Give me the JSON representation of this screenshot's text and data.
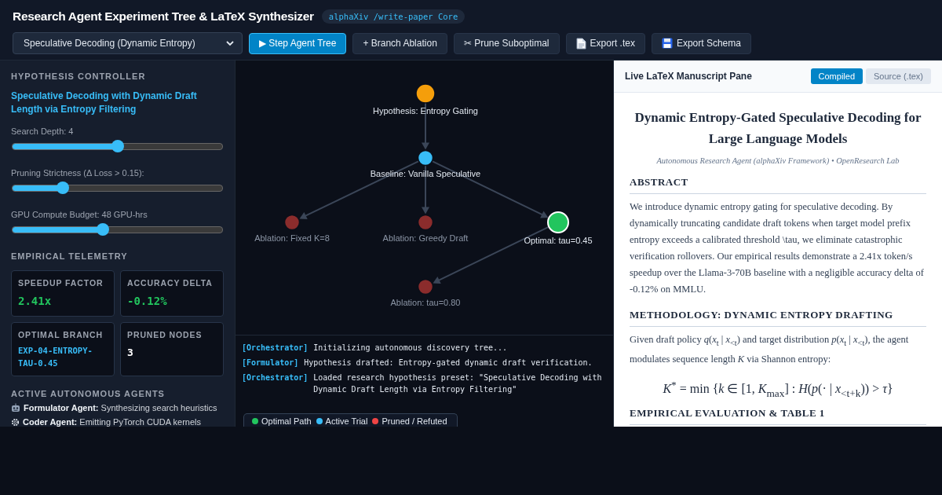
{
  "header": {
    "title": "Research Agent Experiment Tree & LaTeX Synthesizer",
    "badge": "alphaXiv /write-paper Core"
  },
  "toolbar": {
    "preset": "Speculative Decoding (Dynamic Entropy)",
    "buttons": [
      {
        "label": "▶ Step Agent Tree",
        "primary": true
      },
      {
        "label": "+ Branch Ablation",
        "primary": false
      },
      {
        "label": "✂ Prune Suboptimal",
        "primary": false
      },
      {
        "label": "Export .tex",
        "primary": false
      },
      {
        "label": "Export Schema",
        "primary": false
      }
    ]
  },
  "controller": {
    "heading": "HYPOTHESIS CONTROLLER",
    "hypothesis": "Speculative Decoding with Dynamic Draft Length via Entropy Filtering",
    "sliders": [
      {
        "label": "Search Depth: 4",
        "level": 0.5
      },
      {
        "label": "Pruning Strictness (Δ Loss > 0.15):",
        "level": 0.24
      },
      {
        "label": "GPU Compute Budget: 48 GPU-hrs",
        "level": 0.43
      }
    ]
  },
  "telemetry": {
    "heading": "EMPIRICAL TELEMETRY",
    "cards": [
      {
        "label": "SPEEDUP FACTOR",
        "value": "2.41x",
        "kind": "good"
      },
      {
        "label": "ACCURACY DELTA",
        "value": "-0.12%",
        "kind": "good"
      },
      {
        "label": "OPTIMAL BRANCH",
        "value": "EXP-04-ENTROPY-TAU-0.45",
        "kind": "id"
      },
      {
        "label": "PRUNED NODES",
        "value": "3",
        "kind": "plain"
      }
    ]
  },
  "agents": {
    "heading": "ACTIVE AUTONOMOUS AGENTS",
    "items": [
      {
        "name": "Formulator Agent:",
        "task": "Synthesizing search heuristics"
      },
      {
        "name": "Coder Agent:",
        "task": "Emitting PyTorch CUDA kernels"
      }
    ]
  },
  "tree": {
    "label": "Hypothesis: Entropy Gating",
    "kind": "hypothesis",
    "children": [
      {
        "label": "Baseline: Vanilla Speculative",
        "kind": "active",
        "children": [
          {
            "label": "Ablation: Fixed K=8",
            "kind": "pruned"
          },
          {
            "label": "Ablation: Greedy Draft",
            "kind": "pruned"
          },
          {
            "label": "Optimal: tau=0.45",
            "kind": "optimal",
            "children": [
              {
                "label": "Ablation: tau=0.80",
                "kind": "pruned"
              }
            ]
          }
        ]
      }
    ]
  },
  "log": [
    {
      "agent": "[Orchestrator]",
      "message": "Initializing autonomous discovery tree..."
    },
    {
      "agent": "[Formulator]",
      "message": "Hypothesis drafted: Entropy-gated dynamic draft verification."
    },
    {
      "agent": "[Orchestrator]",
      "message": "Loaded research hypothesis preset: \"Speculative Decoding with Dynamic Draft Length via Entropy Filtering\""
    }
  ],
  "legend": [
    {
      "label": "Optimal Path",
      "color": "#22c55e"
    },
    {
      "label": "Active Trial",
      "color": "#38bdf8"
    },
    {
      "label": "Pruned / Refuted",
      "color": "#ef4444"
    }
  ],
  "manuscript": {
    "pane_title": "Live LaTeX Manuscript Pane",
    "tabs": [
      {
        "label": "Compiled",
        "selected": true
      },
      {
        "label": "Source (.tex)",
        "selected": false
      }
    ],
    "title": "Dynamic Entropy-Gated Speculative Decoding for Large Language Models",
    "authors": "Autonomous Research Agent (alphaXiv Framework) • OpenResearch Lab",
    "sections": [
      {
        "heading": "ABSTRACT",
        "paragraphs": [
          "We introduce dynamic entropy gating for speculative decoding. By dynamically truncating candidate draft tokens when target model prefix entropy exceeds a calibrated threshold \\tau, we eliminate catastrophic verification rollovers. Our empirical results demonstrate a 2.41x token/s speedup over the Llama-3-70B baseline with a negligible accuracy delta of -0.12% on MMLU."
        ]
      },
      {
        "heading": "METHODOLOGY: DYNAMIC ENTROPY DRAFTING",
        "paragraphs": [
          "Given draft policy *q*(*x*$_{t}$ | *x*$_{<t}$) and target distribution *p*(*x*$_{t}$ | *x*$_{<t}$), the agent modulates sequence length *K* via Shannon entropy:"
        ],
        "equation": "*K*$^{*}$ = min {*k* ∈ [1, *K*$_{max}$] : *H*(*p*(· | *x*$_{<t+k}$)) > *τ*}"
      },
      {
        "heading": "EMPIRICAL EVALUATION & TABLE 1"
      }
    ]
  }
}
